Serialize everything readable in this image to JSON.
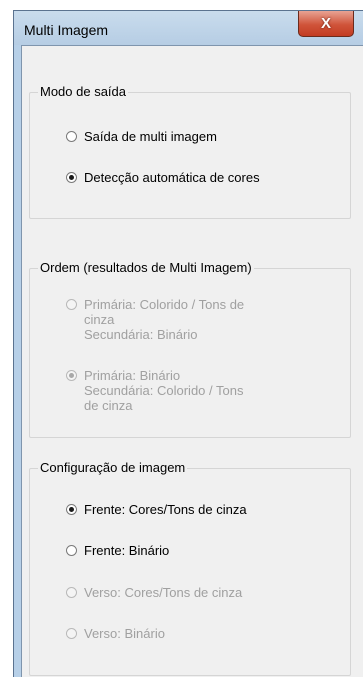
{
  "window": {
    "title": "Multi Imagem",
    "close_symbol": "X"
  },
  "output_mode": {
    "legend": "Modo de saída",
    "options": [
      {
        "label": "Saída de multi imagem",
        "checked": false,
        "enabled": true
      },
      {
        "label": "Detecção automática de cores",
        "checked": true,
        "enabled": true
      }
    ]
  },
  "order": {
    "legend": "Ordem (resultados de Multi Imagem)",
    "options": [
      {
        "lines": [
          "Primária: Colorido / Tons de",
          "cinza",
          "Secundária: Binário"
        ],
        "checked": false,
        "enabled": false
      },
      {
        "lines": [
          "Primária: Binário",
          "Secundária: Colorido / Tons",
          "de cinza"
        ],
        "checked": true,
        "enabled": false
      }
    ]
  },
  "image_config": {
    "legend": "Configuração de imagem",
    "options": [
      {
        "label": "Frente: Cores/Tons de cinza",
        "checked": true,
        "enabled": true
      },
      {
        "label": "Frente: Binário",
        "checked": false,
        "enabled": true
      },
      {
        "label": "Verso: Cores/Tons de cinza",
        "checked": false,
        "enabled": false
      },
      {
        "label": "Verso: Binário",
        "checked": false,
        "enabled": false
      }
    ]
  }
}
